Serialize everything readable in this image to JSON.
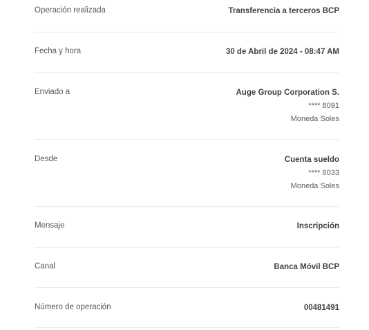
{
  "receipt": {
    "rows": [
      {
        "label": "Operación realizada",
        "value": "Transferencia a terceros BCP"
      },
      {
        "label": "Fecha y hora",
        "value": "30 de Abril de 2024 - 08:47 AM"
      },
      {
        "label": "Enviado a",
        "value": "Auge Group Corporation S.",
        "account": "**** 8091",
        "currency": "Moneda Soles"
      },
      {
        "label": "Desde",
        "value": "Cuenta sueldo",
        "account": "**** 6033",
        "currency": "Moneda Soles"
      },
      {
        "label": "Mensaje",
        "value": "Inscripción"
      },
      {
        "label": "Canal",
        "value": "Banca Móvil BCP"
      },
      {
        "label": "Número de operación",
        "value": "00481491"
      }
    ]
  },
  "colors": {
    "label": "#4f5661",
    "value": "#3d434c",
    "divider": "#e6eef2"
  }
}
